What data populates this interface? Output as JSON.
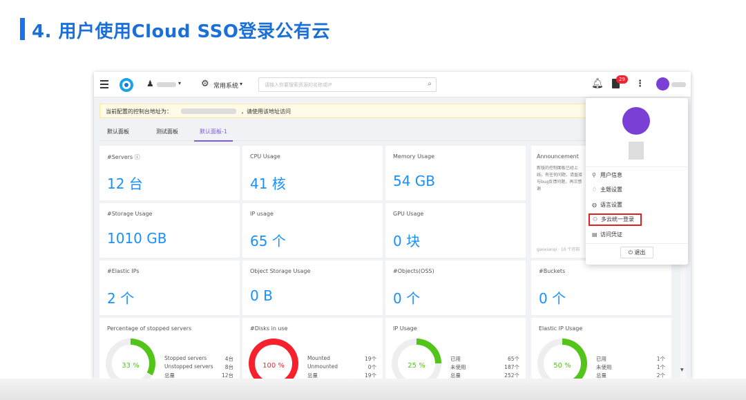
{
  "slide": {
    "title": "4. 用户使用Cloud SSO登录公有云"
  },
  "header": {
    "system_label": "常用系统",
    "search_placeholder": "请输入你要搜索资源的名称或IP",
    "notification_badge": "29"
  },
  "notice": {
    "text_before": "当前配置的控制台地址为：",
    "text_after": "，请使用该地址访问"
  },
  "tabs": [
    {
      "label": "默认面板",
      "active": false
    },
    {
      "label": "测试面板",
      "active": false
    },
    {
      "label": "默认面板-1",
      "active": true
    }
  ],
  "cards": [
    {
      "label": "#Servers ⓘ",
      "value": "12 台"
    },
    {
      "label": "CPU Usage",
      "value": "41 核"
    },
    {
      "label": "Memory Usage",
      "value": "54 GB"
    },
    {
      "label": "#Storage Usage",
      "value": "1010 GB"
    },
    {
      "label": "IP usage",
      "value": "65 个"
    },
    {
      "label": "GPU Usage",
      "value": "0 块"
    },
    {
      "label": "#Elastic IPs",
      "value": "2 个"
    },
    {
      "label": "Object Storage Usage",
      "value": "0 B"
    },
    {
      "label": "#Objects(OSS)",
      "value": "0 个"
    },
    {
      "label": "#Buckets",
      "value": "0 个"
    }
  ],
  "announcement": {
    "label": "Announcement",
    "text": "新版的控制面板已经上线，有任何问题，请直接与bug反馈问题，再次感谢",
    "footer": "gaoxianqi · 10 个月前"
  },
  "gauges": [
    {
      "label": "Percentage of stopped servers",
      "percent": 33,
      "percent_text": "33 %",
      "color": "#52c41a",
      "legend": [
        {
          "k": "Stopped servers",
          "v": "4台"
        },
        {
          "k": "Unstopped servers",
          "v": "8台"
        },
        {
          "k": "总量",
          "v": "12台"
        }
      ]
    },
    {
      "label": "#Disks in use",
      "percent": 100,
      "percent_text": "100 %",
      "color": "#f5222d",
      "legend": [
        {
          "k": "Mounted",
          "v": "19个"
        },
        {
          "k": "Unmounted",
          "v": "0个"
        },
        {
          "k": "总量",
          "v": "19个"
        }
      ]
    },
    {
      "label": "IP Usage",
      "percent": 25,
      "percent_text": "25 %",
      "color": "#52c41a",
      "legend": [
        {
          "k": "已用",
          "v": "65个"
        },
        {
          "k": "未使用",
          "v": "187个"
        },
        {
          "k": "总量",
          "v": "252个"
        }
      ]
    },
    {
      "label": "Elastic IP Usage",
      "percent": 50,
      "percent_text": "50 %",
      "color": "#52c41a",
      "legend": [
        {
          "k": "已用",
          "v": "1个"
        },
        {
          "k": "未使用",
          "v": "1个"
        },
        {
          "k": "总量",
          "v": "2个"
        }
      ]
    }
  ],
  "user_menu": {
    "items": [
      {
        "icon": "user-icon",
        "glyph": "⚲",
        "label": "用户信息"
      },
      {
        "icon": "shirt-icon",
        "glyph": "♢",
        "label": "主题设置"
      },
      {
        "icon": "globe-icon",
        "glyph": "◍",
        "label": "语言设置"
      },
      {
        "icon": "multi-user-icon",
        "glyph": "⚇",
        "label": "多云统一登录",
        "highlighted": true
      },
      {
        "icon": "key-doc-icon",
        "glyph": "▤",
        "label": "访问凭证"
      }
    ],
    "logout_label": "退出"
  }
}
